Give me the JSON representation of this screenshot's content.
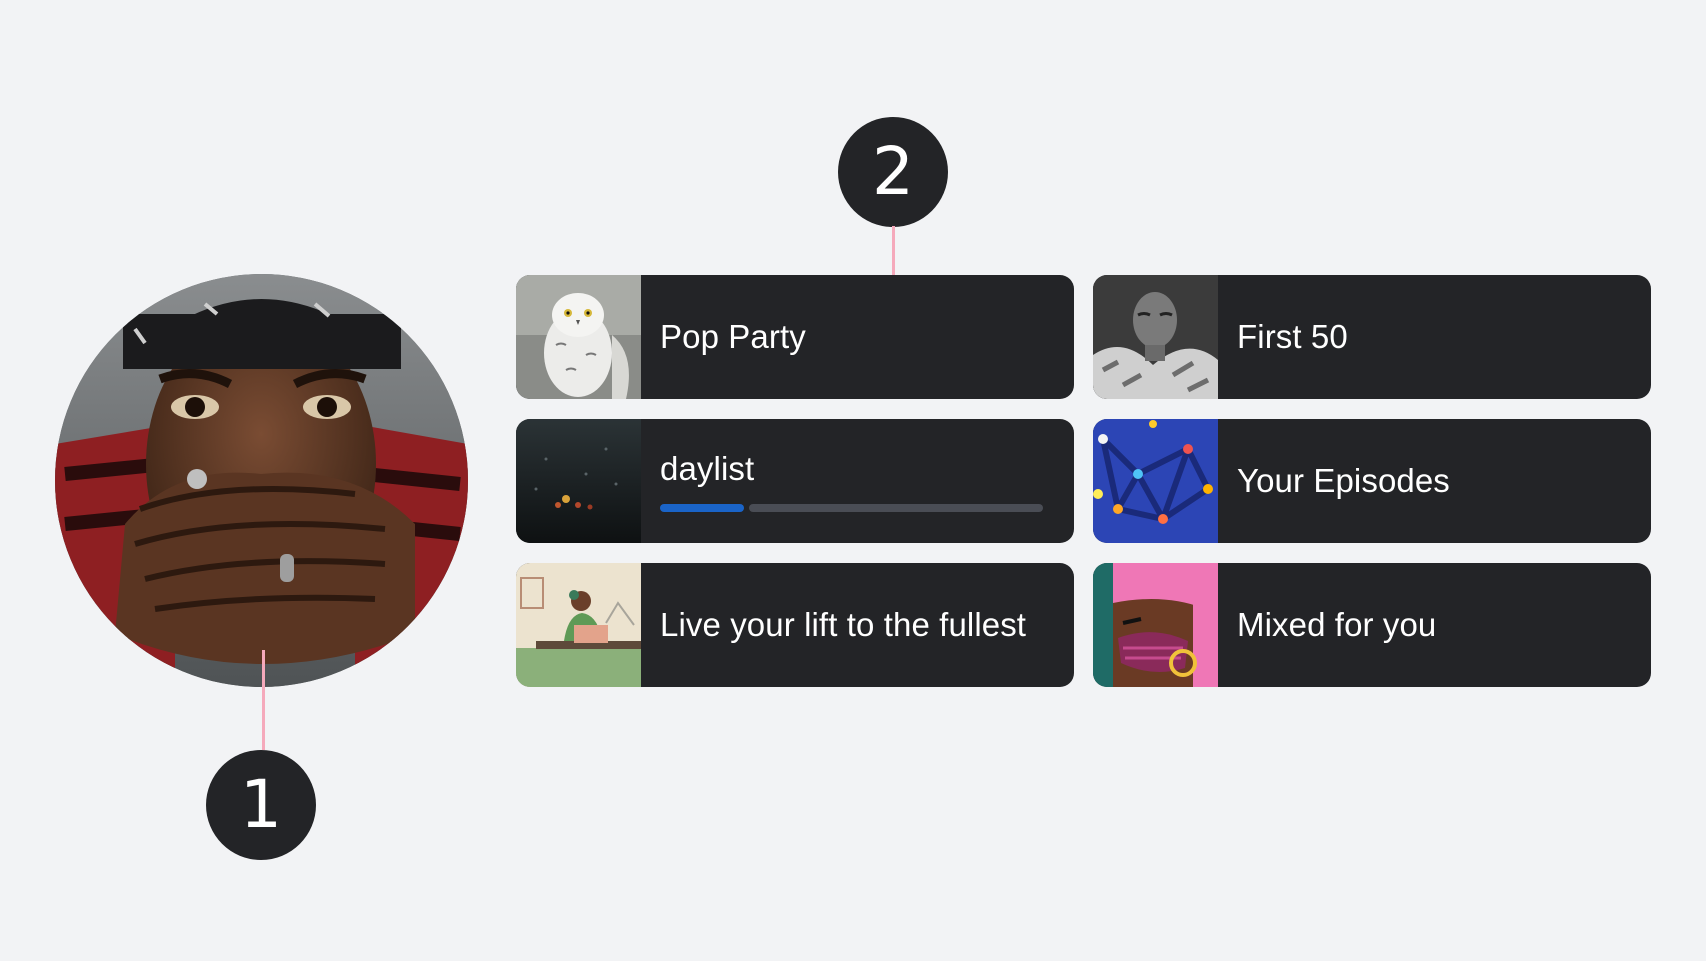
{
  "callouts": {
    "first": "1",
    "second": "2"
  },
  "avatar": {
    "icon": "user-photo"
  },
  "shortcuts": [
    {
      "title": "Pop Party",
      "art": "snowy-owl",
      "progress": null
    },
    {
      "title": "First 50",
      "art": "bw-portrait",
      "progress": null
    },
    {
      "title": "daylist",
      "art": "rainy-window",
      "progress": 0.22
    },
    {
      "title": "Your Episodes",
      "art": "blue-network",
      "progress": null
    },
    {
      "title": "Live your lift to the fullest",
      "art": "illustrated-desk",
      "progress": null
    },
    {
      "title": "Mixed for you",
      "art": "pink-portrait",
      "progress": null
    }
  ],
  "colors": {
    "background": "#f2f3f5",
    "tile": "#232427",
    "badge": "#232427",
    "leader_line": "#f5a9bb",
    "progress_fill": "#1a64c8",
    "progress_track": "#4a4d55"
  }
}
